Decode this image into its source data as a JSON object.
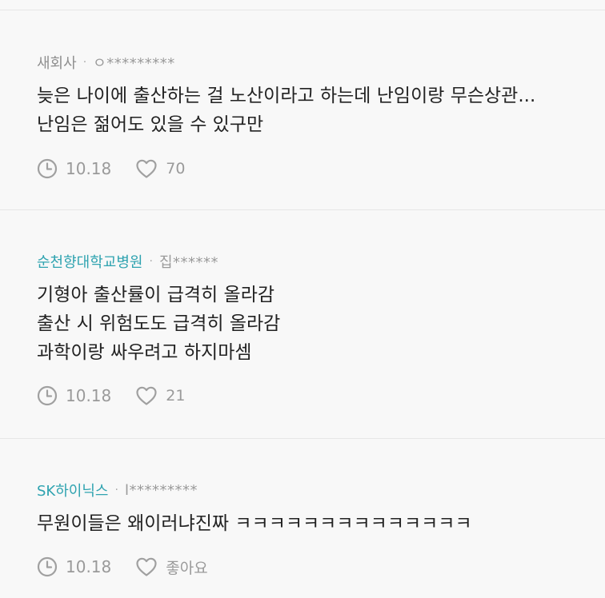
{
  "comments": [
    {
      "company": "새회사",
      "nick": "ㅇ*********",
      "lines": [
        "늦은 나이에 출산하는 걸 노산이라고 하는데 난임이랑 무슨상관...",
        "난임은 젊어도 있을 수 있구만"
      ],
      "date": "10.18",
      "likes": "70"
    },
    {
      "company": "순천향대학교병원",
      "nick": "집******",
      "lines": [
        "기형아 출산률이 급격히 올라감",
        "출산 시 위험도도 급격히 올라감",
        "과학이랑 싸우려고 하지마셈"
      ],
      "date": "10.18",
      "likes": "21"
    },
    {
      "company": "SK하이닉스",
      "nick": "l*********",
      "lines": [
        "무원이들은 왜이러냐진짜 ㅋㅋㅋㅋㅋㅋㅋㅋㅋㅋㅋㅋㅋㅋ"
      ],
      "date": "10.18",
      "likes": "좋아요"
    }
  ],
  "separator": "·",
  "colors": {
    "accent": "#2fa3b0",
    "text": "#222222",
    "muted": "#9a9a9a",
    "background": "#f8f8f8"
  },
  "icons": {
    "date": "clock-icon",
    "like": "heart-icon"
  }
}
